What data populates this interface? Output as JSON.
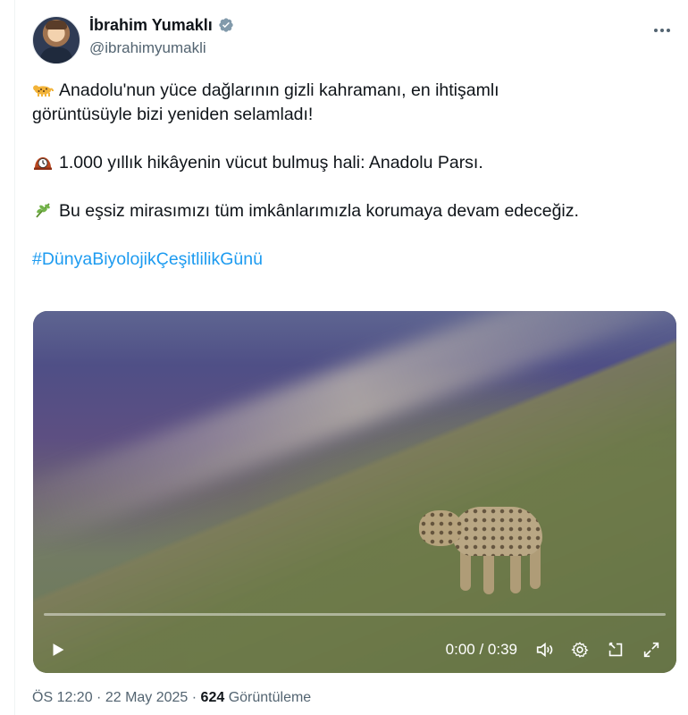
{
  "author": {
    "name": "İbrahim Yumaklı",
    "handle": "@ibrahimyumakli",
    "avatar_icon": "avatar-photo",
    "verified": true
  },
  "tweet": {
    "line1": "Anadolu'nun yüce dağlarının gizli kahramanı, en ihtişamlı",
    "line2": "görüntüsüyle bizi yeniden selamladı!",
    "line3": "1.000 yıllık hikâyenin vücut bulmuş hali: Anadolu Parsı.",
    "line4": "Bu eşsiz mirasımızı tüm imkânlarımızla korumaya devam edeceğiz.",
    "hashtag": "#DünyaBiyolojikÇeşitlilikGünü",
    "emoji_line1": "leopard-emoji",
    "emoji_line3": "mantelpiece-clock-emoji",
    "emoji_line4": "herb-emoji"
  },
  "video": {
    "time": "0:00 / 0:39",
    "progress": 0,
    "icons": [
      "play-icon",
      "volume-icon",
      "settings-icon",
      "pip-icon",
      "fullscreen-icon"
    ]
  },
  "meta": {
    "time": "ÖS 12:20 · 22 May 2025 · ",
    "views": "624",
    "views_label": " Görüntüleme"
  },
  "colors": {
    "hashtag": "#1d9bf0",
    "secondary_text": "#536471",
    "verified": "#829aab"
  }
}
